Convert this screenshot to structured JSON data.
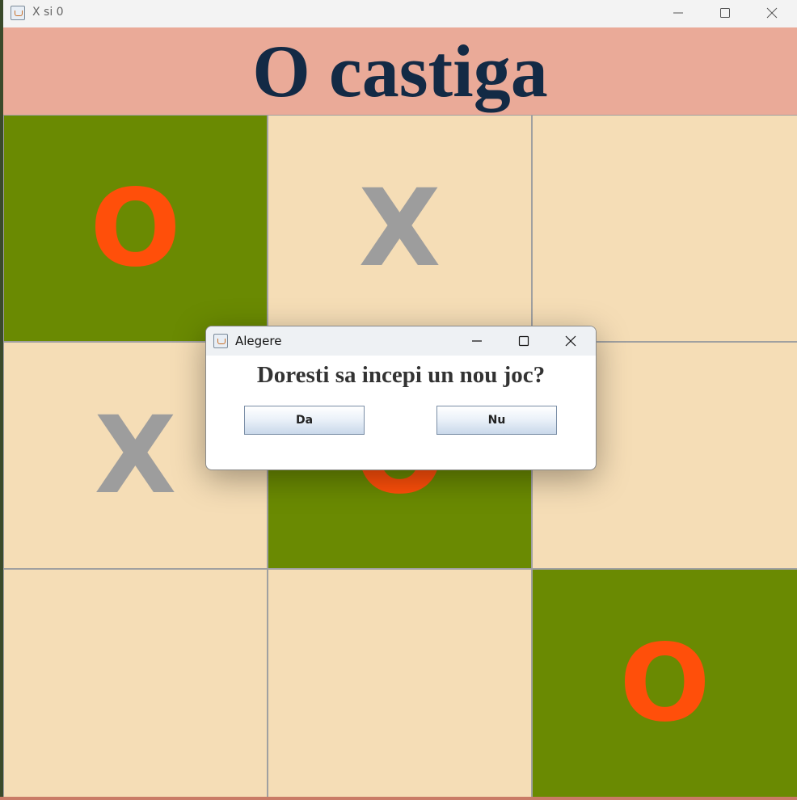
{
  "window": {
    "title": "X si 0",
    "icon": "java-app-icon",
    "controls": [
      "minimize-icon",
      "maximize-icon",
      "close-icon"
    ]
  },
  "banner": {
    "text": "O castiga",
    "background": "#eaaa98",
    "color": "#132a45"
  },
  "board": {
    "cells": [
      {
        "mark": "O",
        "winning": true
      },
      {
        "mark": "X",
        "winning": false
      },
      {
        "mark": "",
        "winning": false
      },
      {
        "mark": "X",
        "winning": false
      },
      {
        "mark": "O",
        "winning": true
      },
      {
        "mark": "",
        "winning": false
      },
      {
        "mark": "",
        "winning": false
      },
      {
        "mark": "",
        "winning": false
      },
      {
        "mark": "O",
        "winning": true
      }
    ],
    "colors": {
      "empty_cell": "#f5ddb6",
      "winning_cell": "#6a8a02",
      "x_mark": "#9d9d9d",
      "o_mark": "#ff4f0a"
    }
  },
  "dialog": {
    "title": "Alegere",
    "icon": "java-app-icon",
    "message": "Doresti sa incepi un nou joc?",
    "yes_label": "Da",
    "no_label": "Nu"
  }
}
